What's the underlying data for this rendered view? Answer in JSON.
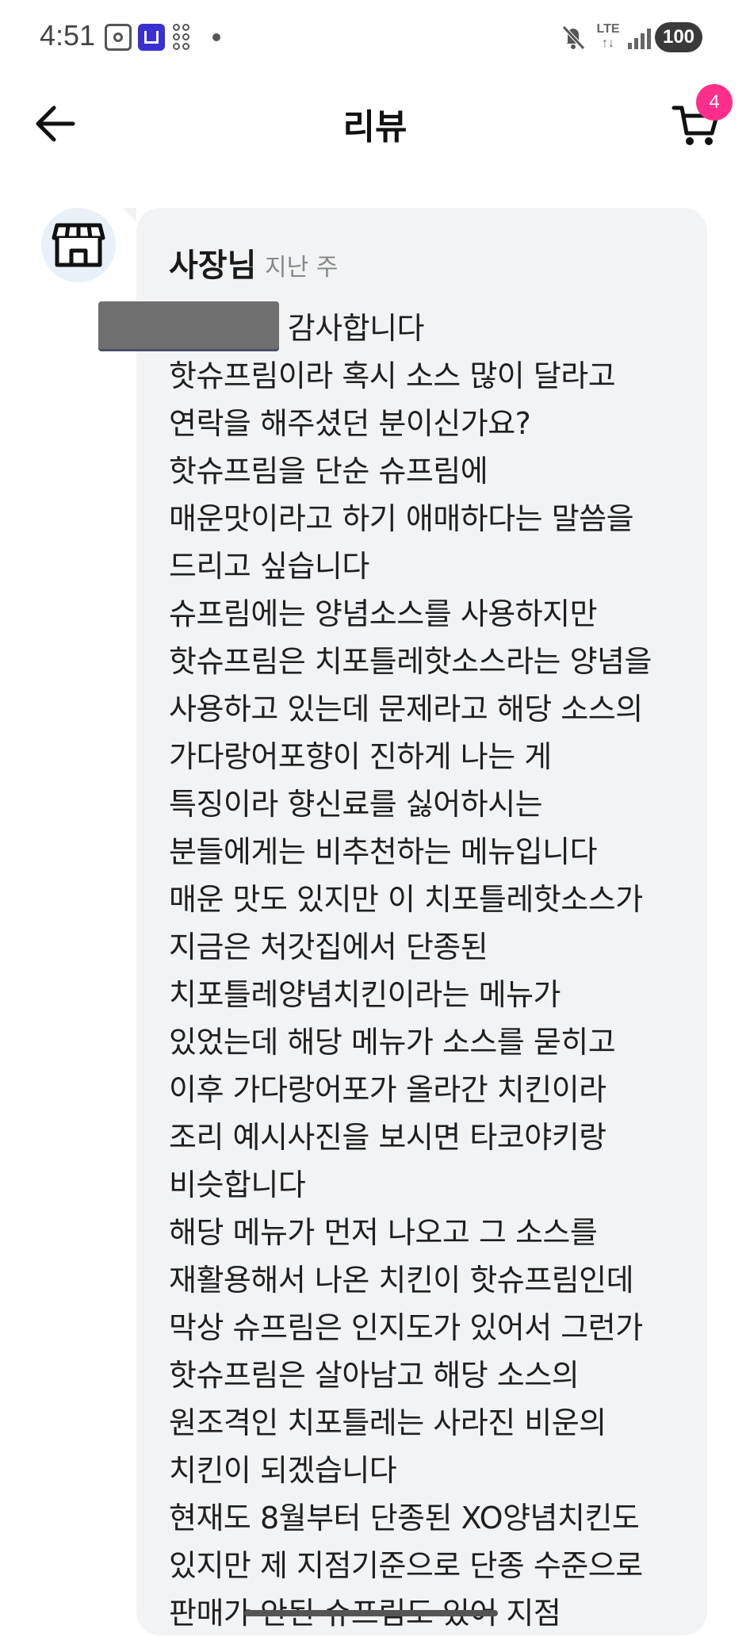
{
  "status_bar": {
    "time": "4:51",
    "network": "LTE",
    "battery": "100",
    "icons": [
      "screen-capture-icon",
      "home-app-icon",
      "grid-app-icon",
      "notification-dot-icon",
      "mute-icon",
      "lte-icon",
      "signal-icon",
      "battery-icon"
    ]
  },
  "header": {
    "title": "리뷰",
    "back_icon": "arrow-left-icon",
    "cart_icon": "cart-icon",
    "cart_count": "4",
    "badge_color": "#ff2e8a"
  },
  "reply": {
    "avatar_icon": "storefront-icon",
    "author": "사장님",
    "time": "지난 주",
    "text": "님,  리뷰 감사합니다\n핫슈프림이라 혹시 소스 많이 달라고\n연락을 해주셨던 분이신가요?\n핫슈프림을 단순 슈프림에\n매운맛이라고 하기 애매하다는 말씀을\n드리고 싶습니다\n슈프림에는 양념소스를 사용하지만\n핫슈프림은 치포틀레핫소스라는 양념을\n사용하고 있는데 문제라고 해당 소스의\n가다랑어포향이 진하게 나는 게\n특징이라 향신료를 싫어하시는\n분들에게는 비추천하는 메뉴입니다\n매운 맛도 있지만 이 치포틀레핫소스가\n지금은 처갓집에서 단종된\n치포틀레양념치킨이라는 메뉴가\n있었는데 해당 메뉴가 소스를 묻히고\n이후 가다랑어포가 올라간 치킨이라\n조리 예시사진을 보시면 타코야키랑\n비슷합니다\n해당 메뉴가 먼저 나오고 그 소스를\n재활용해서 나온 치킨이 핫슈프림인데\n막상 슈프림은 인지도가 있어서 그런가\n핫슈프림은 살아남고 해당 소스의\n원조격인 치포틀레는 사라진 비운의\n치킨이 되겠습니다\n현재도 8월부터 단종된 XO양념치킨도\n있지만 제 지점기준으로 단종 수준으로\n판매가 안된 슈프림도 있어 지점"
  }
}
